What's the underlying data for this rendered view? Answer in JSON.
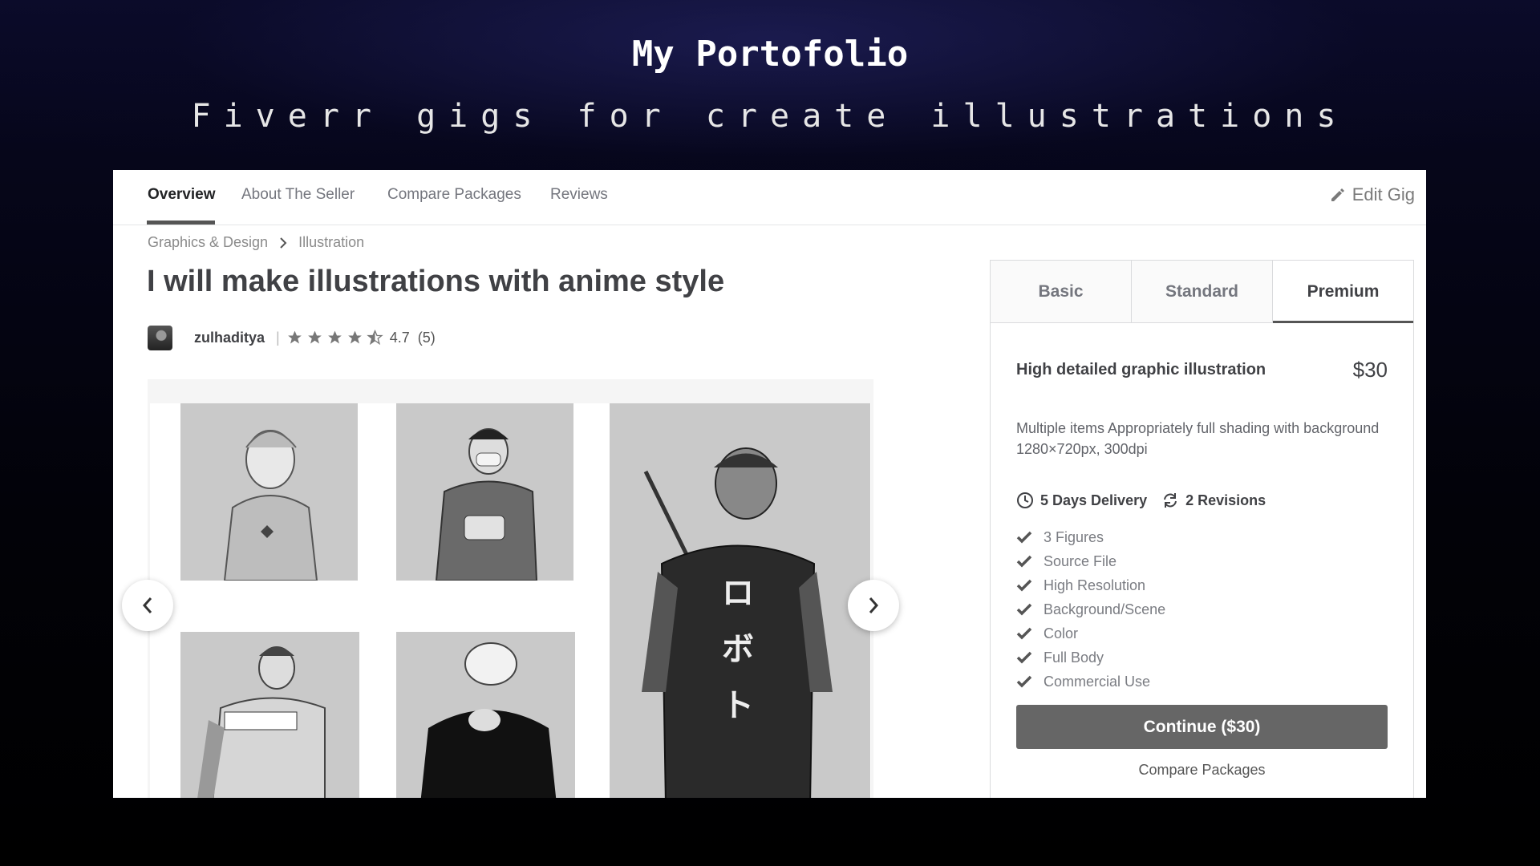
{
  "hero": {
    "title": "My Portofolio",
    "subtitle": "Fiverr gigs for create illustrations"
  },
  "nav": {
    "tabs": [
      "Overview",
      "About The Seller",
      "Compare Packages",
      "Reviews"
    ],
    "active_tab": "Overview",
    "edit_label": "Edit Gig",
    "edit_icon": "pencil-icon"
  },
  "breadcrumb": [
    "Graphics & Design",
    "Illustration"
  ],
  "gig": {
    "title": "I will make illustrations with anime style",
    "seller": "zulhaditya",
    "rating": "4.7",
    "rating_count": "(5)",
    "stars": 4.5
  },
  "gallery": {
    "prev_icon": "chevron-left-icon",
    "next_icon": "chevron-right-icon",
    "images": [
      "illustration-1",
      "illustration-2",
      "illustration-3",
      "illustration-4",
      "illustration-5"
    ]
  },
  "pricing": {
    "tabs": [
      "Basic",
      "Standard",
      "Premium"
    ],
    "active_tab": "Premium",
    "package_name": "High detailed graphic illustration",
    "price": "$30",
    "description": "Multiple items Appropriately full shading with background 1280×720px, 300dpi",
    "delivery": "5 Days Delivery",
    "revisions": "2 Revisions",
    "features": [
      "3 Figures",
      "Source File",
      "High Resolution",
      "Background/Scene",
      "Color",
      "Full Body",
      "Commercial Use"
    ],
    "cta": "Continue ($30)",
    "compare_link": "Compare Packages"
  },
  "colors": {
    "text_dark": "#404145",
    "text_muted": "#74767e",
    "button": "#666666"
  }
}
